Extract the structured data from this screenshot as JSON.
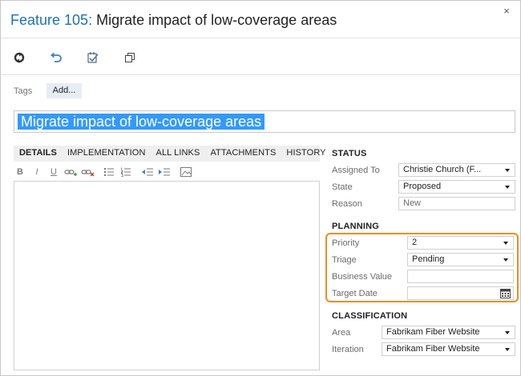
{
  "header": {
    "work_item_type": "Feature 105:",
    "work_item_title": "Migrate impact of low-coverage areas",
    "close_glyph": "×"
  },
  "toolbar": {
    "icons": [
      "refresh-icon",
      "undo-icon",
      "copy-template-icon",
      "copy-icon"
    ]
  },
  "tags": {
    "label": "Tags",
    "add_label": "Add..."
  },
  "title_field": {
    "value": "Migrate impact of low-coverage areas"
  },
  "tabs": [
    {
      "label": "DETAILS",
      "active": true
    },
    {
      "label": "IMPLEMENTATION",
      "active": false
    },
    {
      "label": "ALL LINKS",
      "active": false
    },
    {
      "label": "ATTACHMENTS",
      "active": false
    },
    {
      "label": "HISTORY",
      "active": false
    }
  ],
  "editor": {
    "bold": "B",
    "italic": "I",
    "underline": "U",
    "value": ""
  },
  "status": {
    "heading": "STATUS",
    "assigned_to": {
      "label": "Assigned To",
      "value": "Christie Church (F..."
    },
    "state": {
      "label": "State",
      "value": "Proposed"
    },
    "reason": {
      "label": "Reason",
      "value": "New"
    }
  },
  "planning": {
    "heading": "PLANNING",
    "priority": {
      "label": "Priority",
      "value": "2"
    },
    "triage": {
      "label": "Triage",
      "value": "Pending"
    },
    "business_value": {
      "label": "Business Value",
      "value": ""
    },
    "target_date": {
      "label": "Target Date",
      "value": ""
    }
  },
  "classification": {
    "heading": "CLASSIFICATION",
    "area": {
      "label": "Area",
      "value": "Fabrikam Fiber Website"
    },
    "iteration": {
      "label": "Iteration",
      "value": "Fabrikam Fiber Website"
    }
  },
  "colors": {
    "accent_blue": "#1f6fb5",
    "selection": "#3399ff",
    "highlight_orange": "#f08d1a",
    "tag_bg": "#e6edf5"
  }
}
